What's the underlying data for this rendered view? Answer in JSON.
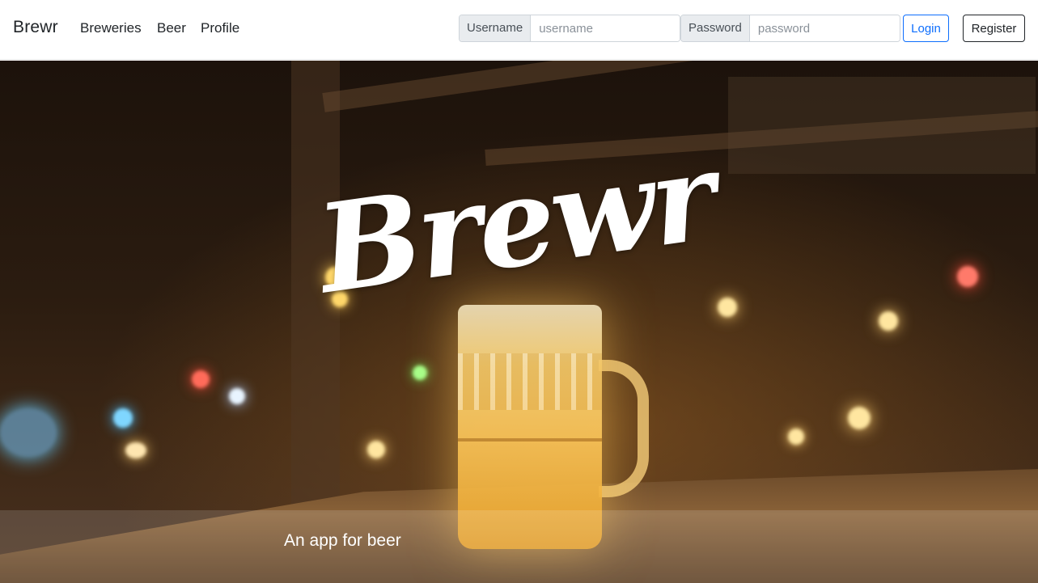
{
  "navbar": {
    "brand": "Brewr",
    "links": [
      "Breweries",
      "Beer",
      "Profile"
    ],
    "username_label": "Username",
    "username_placeholder": "username",
    "password_label": "Password",
    "password_placeholder": "password",
    "login_label": "Login",
    "register_label": "Register"
  },
  "hero": {
    "logo": "Brewr",
    "caption": "An app for beer"
  },
  "colors": {
    "accent": "#0d6efd",
    "text": "#212529",
    "input_label_bg": "#e9ecef"
  }
}
